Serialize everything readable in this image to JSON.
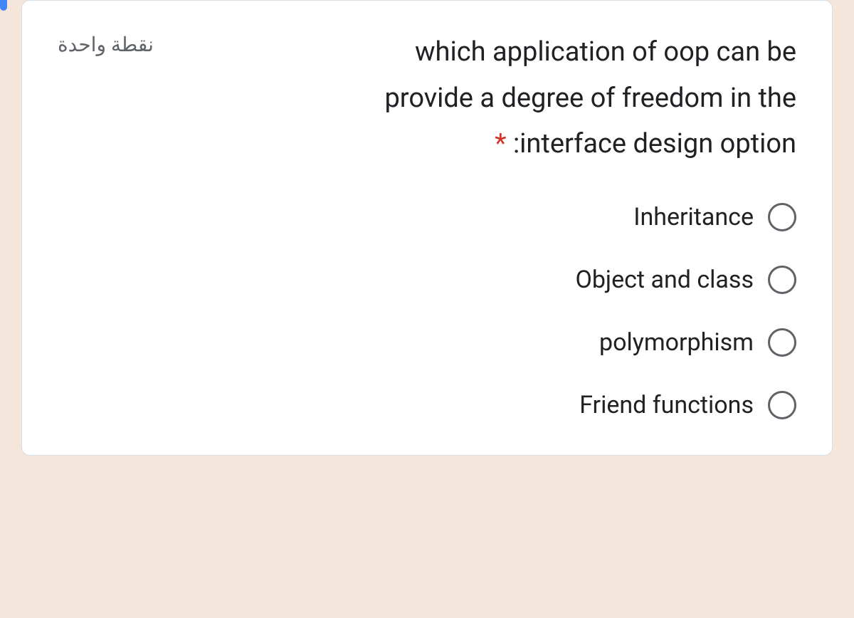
{
  "question": {
    "points_label": "نقطة واحدة",
    "text_line1": "which application of oop can be",
    "text_line2": "provide a degree of freedom in the",
    "text_line3": ":interface design option",
    "required_marker": "*"
  },
  "options": [
    {
      "label": "Inheritance"
    },
    {
      "label": "Object and class"
    },
    {
      "label": "polymorphism"
    },
    {
      "label": "Friend functions"
    }
  ]
}
